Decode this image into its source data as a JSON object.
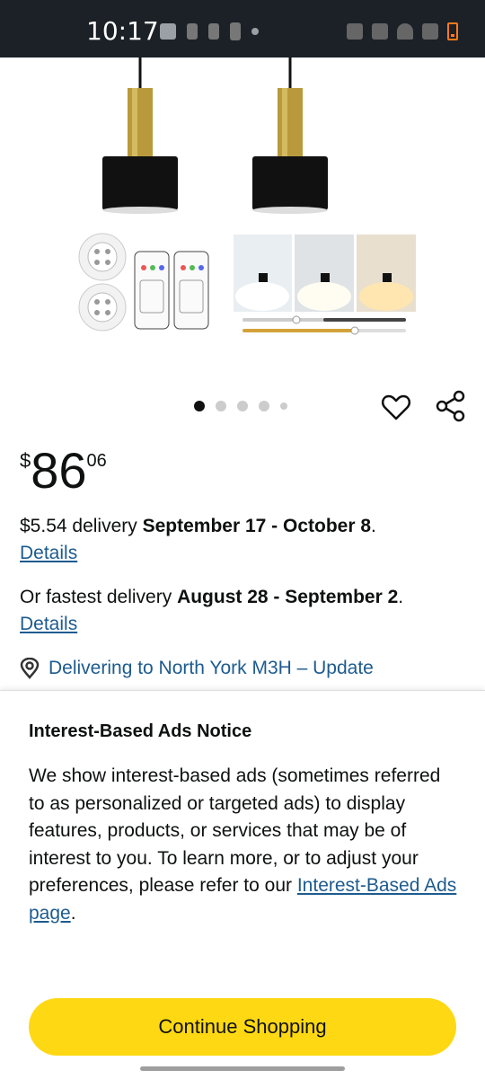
{
  "status_bar": {
    "time": "10:17"
  },
  "product": {
    "image_alt": "Black and gold pendant wall lights with remote controls",
    "carousel": {
      "count": 5,
      "active_index": 0
    }
  },
  "price": {
    "symbol": "$",
    "whole": "86",
    "fraction": "06"
  },
  "delivery": {
    "standard_prefix": "$5.54 delivery ",
    "standard_dates": "September 17 - October 8",
    "standard_suffix": ".",
    "details_link_1": "Details",
    "fastest_prefix": "Or fastest delivery ",
    "fastest_dates": "August 28 - September 2",
    "fastest_suffix": ".",
    "details_link_2": "Details",
    "location_text": "Delivering to North York M3H – Update"
  },
  "ads_notice": {
    "title": "Interest-Based Ads Notice",
    "body": "We show interest-based ads (sometimes referred to as personalized or targeted ads) to display features, products, or services that may be of interest to you. To learn more, or to adjust your preferences, please refer to our ",
    "link": "Interest-Based Ads page",
    "body_end": ".",
    "button": "Continue Shopping"
  },
  "colors": {
    "status_bar_bg": "#1b2127",
    "link": "#1d5b8f",
    "button_bg": "#ffd814"
  }
}
